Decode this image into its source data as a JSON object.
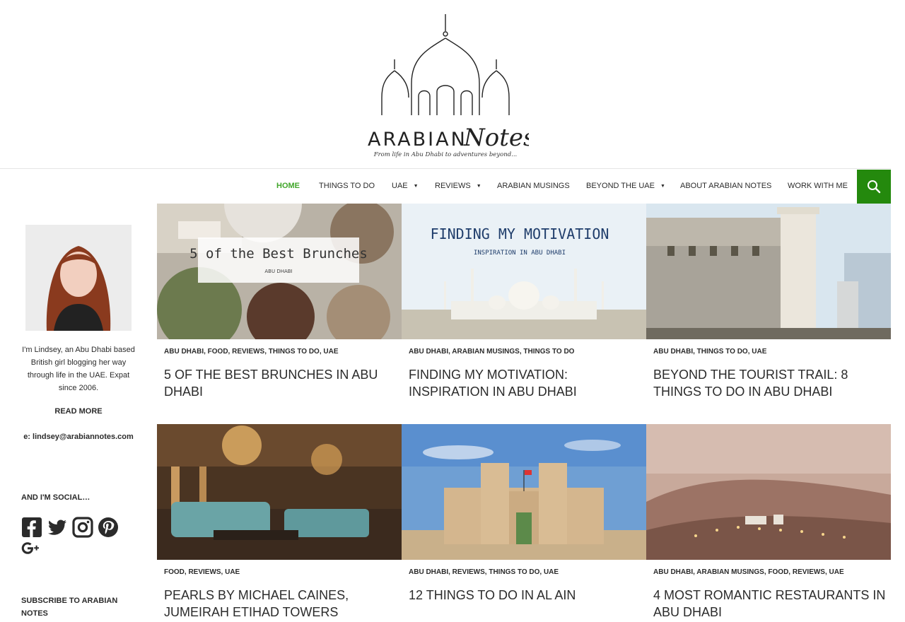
{
  "site": {
    "logo_text": "ARABIANNotes",
    "logo_tagline": "From life in Abu Dhabi to adventures beyond..."
  },
  "nav": {
    "items": [
      {
        "label": "HOME",
        "active": true,
        "has_dropdown": false
      },
      {
        "label": "THINGS TO DO",
        "active": false,
        "has_dropdown": false
      },
      {
        "label": "UAE",
        "active": false,
        "has_dropdown": true
      },
      {
        "label": "REVIEWS",
        "active": false,
        "has_dropdown": true
      },
      {
        "label": "ARABIAN MUSINGS",
        "active": false,
        "has_dropdown": false
      },
      {
        "label": "BEYOND THE UAE",
        "active": false,
        "has_dropdown": true
      },
      {
        "label": "ABOUT ARABIAN NOTES",
        "active": false,
        "has_dropdown": false
      },
      {
        "label": "WORK WITH ME",
        "active": false,
        "has_dropdown": false
      }
    ],
    "search_icon": "search-icon"
  },
  "sidebar": {
    "bio": "I'm Lindsey, an Abu Dhabi based British girl blogging her way through life in the UAE. Expat since 2006.",
    "read_more": "READ MORE",
    "email": "e: lindsey@arabiannotes.com",
    "social_title": "AND I'M SOCIAL…",
    "social_icons": [
      "facebook-icon",
      "twitter-icon",
      "instagram-icon",
      "pinterest-icon",
      "google-plus-icon"
    ],
    "subscribe_title": "SUBSCRIBE TO ARABIAN NOTES"
  },
  "posts": [
    {
      "categories": "ABU DHABI, FOOD, REVIEWS, THINGS TO DO, UAE",
      "title": "5 OF THE BEST BRUNCHES IN ABU DHABI",
      "image_text": "5 of the Best Brunches",
      "image_subtext": "ABU DHABI"
    },
    {
      "categories": "ABU DHABI, ARABIAN MUSINGS, THINGS TO DO",
      "title": "FINDING MY MOTIVATION: INSPIRATION IN ABU DHABI",
      "image_text": "FINDING MY MOTIVATION",
      "image_subtext": "INSPIRATION IN ABU DHABI"
    },
    {
      "categories": "ABU DHABI, THINGS TO DO, UAE",
      "title": "BEYOND THE TOURIST TRAIL: 8 THINGS TO DO IN ABU DHABI"
    },
    {
      "categories": "FOOD, REVIEWS, UAE",
      "title": "PEARLS BY MICHAEL CAINES, JUMEIRAH ETIHAD TOWERS"
    },
    {
      "categories": "ABU DHABI, REVIEWS, THINGS TO DO, UAE",
      "title": "12 THINGS TO DO IN AL AIN"
    },
    {
      "categories": "ABU DHABI, ARABIAN MUSINGS, FOOD, REVIEWS, UAE",
      "title": "4 MOST ROMANTIC RESTAURANTS IN ABU DHABI"
    }
  ],
  "colors": {
    "accent": "#24890d",
    "nav_active": "#41a62a",
    "text": "#2b2b2b"
  }
}
